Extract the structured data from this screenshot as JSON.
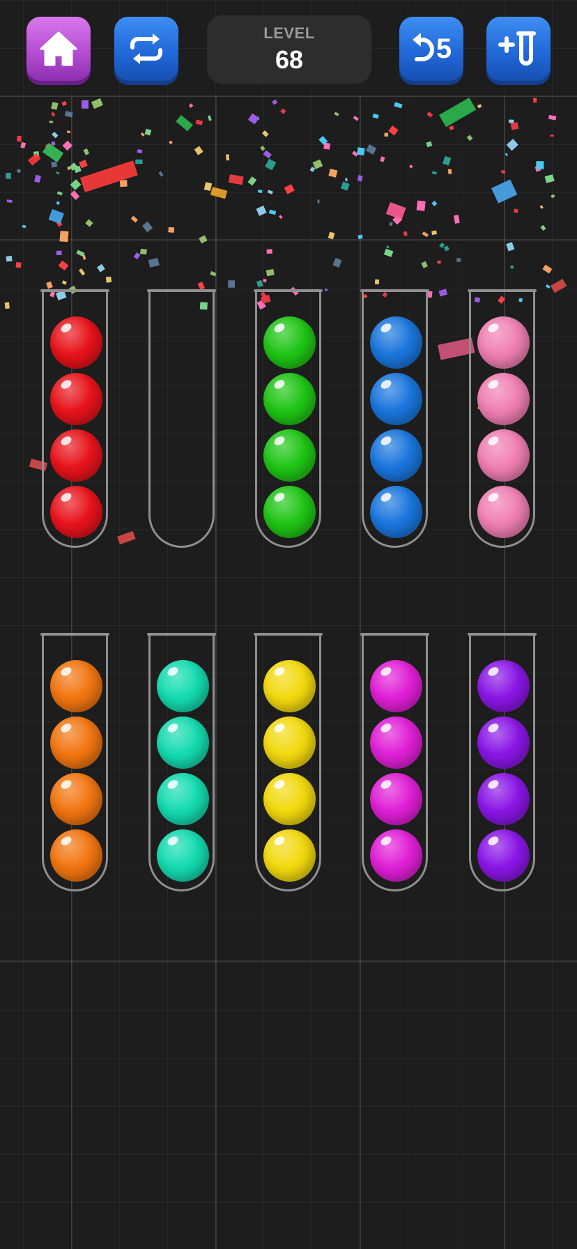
{
  "toolbar": {
    "home_icon": "home-icon",
    "restart_icon": "restart-icon",
    "undo_icon": "undo-icon",
    "undo_count": "5",
    "add_tube_icon": "add-tube-icon"
  },
  "level": {
    "title": "LEVEL",
    "number": "68"
  },
  "colors": {
    "red": "#e8131b",
    "green": "#1fc515",
    "blue": "#1a76dd",
    "pink": "#f07fb2",
    "orange": "#f27510",
    "teal": "#14dbb0",
    "yellow": "#f2d90e",
    "magenta": "#e01fd6",
    "purple": "#8a16e6",
    "home_button": "#c05ddc",
    "action_button": "#2874e0"
  },
  "tubes": [
    {
      "balls": [
        "red",
        "red",
        "red",
        "red"
      ]
    },
    {
      "balls": []
    },
    {
      "balls": [
        "green",
        "green",
        "green",
        "green"
      ]
    },
    {
      "balls": [
        "blue",
        "blue",
        "blue",
        "blue"
      ]
    },
    {
      "balls": [
        "pink",
        "pink",
        "pink",
        "pink"
      ]
    },
    {
      "balls": [
        "orange",
        "orange",
        "orange",
        "orange"
      ]
    },
    {
      "balls": [
        "teal",
        "teal",
        "teal",
        "teal"
      ]
    },
    {
      "balls": [
        "yellow",
        "yellow",
        "yellow",
        "yellow"
      ]
    },
    {
      "balls": [
        "magenta",
        "magenta",
        "magenta",
        "magenta"
      ]
    },
    {
      "balls": [
        "purple",
        "purple",
        "purple",
        "purple"
      ]
    }
  ],
  "effects": {
    "confetti": true
  }
}
